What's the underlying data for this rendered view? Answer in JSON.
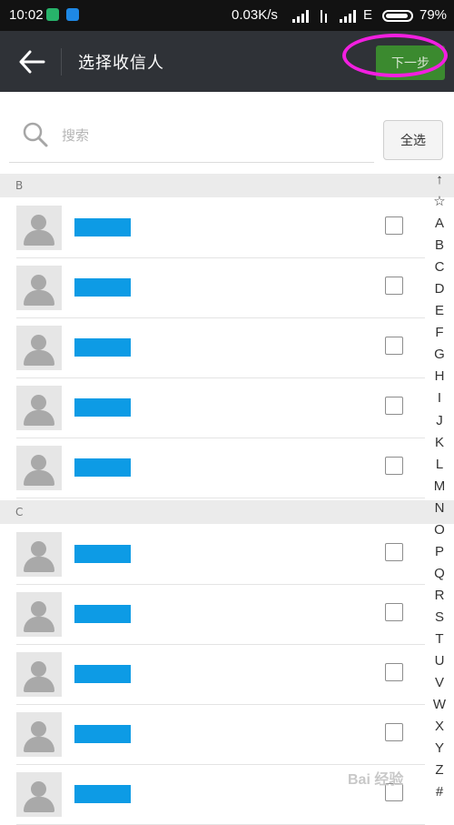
{
  "status_bar": {
    "time": "10:02",
    "network_speed": "0.03K/s",
    "network_type": "E",
    "battery": "79%",
    "battery_level": 0.79
  },
  "header": {
    "title": "选择收信人",
    "next_label": "下一步"
  },
  "search": {
    "placeholder": "搜索",
    "select_all_label": "全选"
  },
  "sections": [
    {
      "letter": "B",
      "contacts": [
        {
          "name": ""
        },
        {
          "name": ""
        },
        {
          "name": ""
        },
        {
          "name": ""
        },
        {
          "name": ""
        }
      ]
    },
    {
      "letter": "C",
      "contacts": [
        {
          "name": ""
        },
        {
          "name": ""
        },
        {
          "name": ""
        },
        {
          "name": ""
        },
        {
          "name": ""
        }
      ]
    }
  ],
  "index_bar": [
    "↑",
    "☆",
    "A",
    "B",
    "C",
    "D",
    "E",
    "F",
    "G",
    "H",
    "I",
    "J",
    "K",
    "L",
    "M",
    "N",
    "O",
    "P",
    "Q",
    "R",
    "S",
    "T",
    "U",
    "V",
    "W",
    "X",
    "Y",
    "Z",
    "#"
  ],
  "colors": {
    "header_bg": "#2f3237",
    "next_button": "#3b8a2f",
    "redacted_name": "#0d9be5",
    "highlight_circle": "#f21fe0"
  },
  "watermark": "Bai 经验"
}
